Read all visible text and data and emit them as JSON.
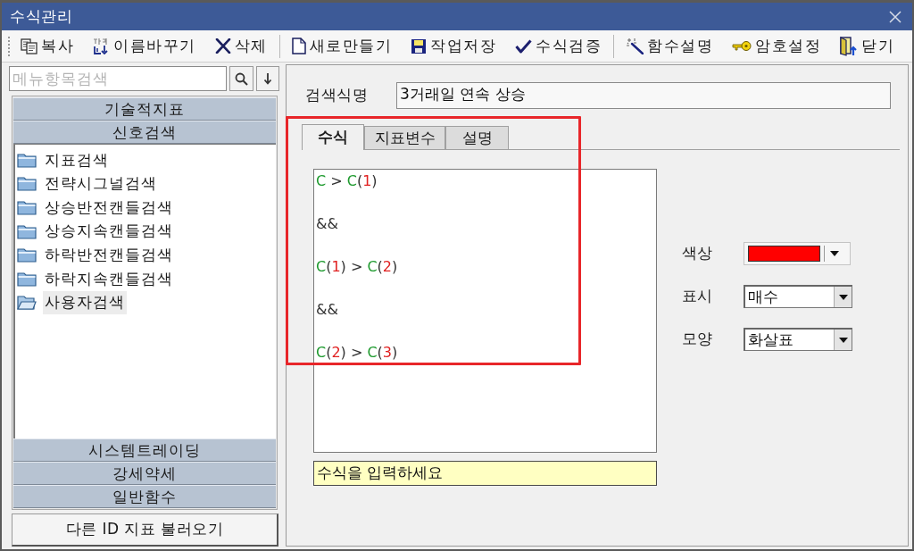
{
  "window": {
    "title": "수식관리"
  },
  "toolbar": {
    "groups": [
      {
        "buttons": [
          {
            "kind": "copy",
            "label": "복사"
          },
          {
            "kind": "rename",
            "label": "이름바꾸기"
          },
          {
            "kind": "delete",
            "label": "삭제"
          }
        ]
      },
      {
        "buttons": [
          {
            "kind": "new",
            "label": "새로만들기"
          },
          {
            "kind": "save",
            "label": "작업저장"
          },
          {
            "kind": "verify",
            "label": "수식검증"
          }
        ]
      },
      {
        "buttons": [
          {
            "kind": "function-help",
            "label": "함수설명"
          },
          {
            "kind": "password",
            "label": "암호설정"
          },
          {
            "kind": "close",
            "label": "닫기"
          }
        ]
      }
    ]
  },
  "sidebar": {
    "search": {
      "placeholder": "메뉴항목검색"
    },
    "sections": [
      {
        "label": "기술적지표",
        "expanded": false
      },
      {
        "label": "신호검색",
        "expanded": true,
        "items": [
          {
            "label": "지표검색",
            "selected": false
          },
          {
            "label": "전략시그널검색",
            "selected": false
          },
          {
            "label": "상승반전캔들검색",
            "selected": false
          },
          {
            "label": "상승지속캔들검색",
            "selected": false
          },
          {
            "label": "하락반전캔들검색",
            "selected": false
          },
          {
            "label": "하락지속캔들검색",
            "selected": false
          },
          {
            "label": "사용자검색",
            "selected": true
          }
        ]
      },
      {
        "label": "시스템트레이딩",
        "expanded": false
      },
      {
        "label": "강세약세",
        "expanded": false
      },
      {
        "label": "일반함수",
        "expanded": false
      }
    ],
    "load_button": "다른 ID 지표 불러오기"
  },
  "editor": {
    "name_label": "검색식명",
    "name_value": "3거래일 연속 상승",
    "tabs": [
      {
        "label": "수식",
        "selected": true
      },
      {
        "label": "지표변수",
        "selected": false
      },
      {
        "label": "설명",
        "selected": false
      }
    ],
    "formula_lines": [
      {
        "tokens": [
          {
            "kind": "field",
            "text": "C"
          },
          {
            "kind": "operator",
            "text": " > "
          },
          {
            "kind": "field",
            "text": "C"
          },
          {
            "kind": "operator",
            "text": "("
          },
          {
            "kind": "number",
            "text": "1"
          },
          {
            "kind": "operator",
            "text": ")"
          }
        ]
      },
      {
        "tokens": [
          {
            "kind": "operator",
            "text": "&&"
          }
        ]
      },
      {
        "tokens": [
          {
            "kind": "field",
            "text": "C"
          },
          {
            "kind": "operator",
            "text": "("
          },
          {
            "kind": "number",
            "text": "1"
          },
          {
            "kind": "operator",
            "text": ") > "
          },
          {
            "kind": "field",
            "text": "C"
          },
          {
            "kind": "operator",
            "text": "("
          },
          {
            "kind": "number",
            "text": "2"
          },
          {
            "kind": "operator",
            "text": ")"
          }
        ]
      },
      {
        "tokens": [
          {
            "kind": "operator",
            "text": "&&"
          }
        ]
      },
      {
        "tokens": [
          {
            "kind": "field",
            "text": "C"
          },
          {
            "kind": "operator",
            "text": "("
          },
          {
            "kind": "number",
            "text": "2"
          },
          {
            "kind": "operator",
            "text": ") > "
          },
          {
            "kind": "field",
            "text": "C"
          },
          {
            "kind": "operator",
            "text": "("
          },
          {
            "kind": "number",
            "text": "3"
          },
          {
            "kind": "operator",
            "text": ")"
          }
        ]
      }
    ],
    "hint": "수식을 입력하세요",
    "properties": [
      {
        "kind": "color",
        "label": "색상",
        "color": "#ff0000"
      },
      {
        "kind": "select",
        "label": "표시",
        "value": "매수"
      },
      {
        "kind": "select",
        "label": "모양",
        "value": "화살표"
      }
    ]
  },
  "highlight": {
    "kind": "rectangle"
  }
}
